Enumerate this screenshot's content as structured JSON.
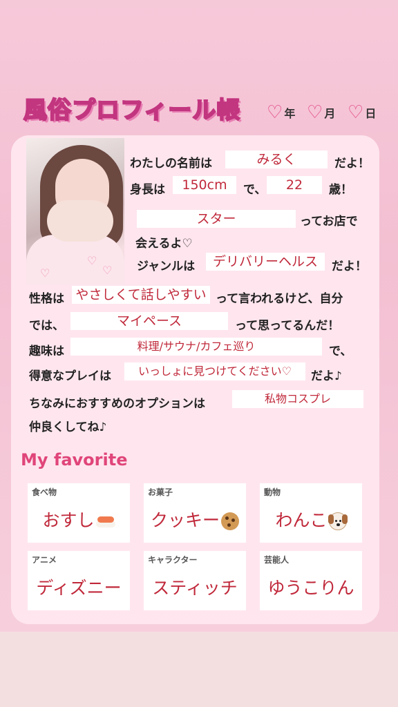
{
  "header": {
    "title": "風俗プロフィール帳",
    "year_label": "年",
    "month_label": "月",
    "day_label": "日"
  },
  "profile": {
    "name_prefix": "わたしの名前は",
    "name": "みるく",
    "name_suffix": "だよ！",
    "height_prefix": "身長は",
    "height": "150cm",
    "height_mid": "で、",
    "age": "22",
    "age_suffix": "歳！",
    "shop": "スター",
    "shop_suffix": "ってお店で",
    "meet_text": "会えるよ♡",
    "genre_prefix": "ジャンルは",
    "genre": "デリバリーヘルス",
    "genre_suffix": "だよ！",
    "personality_prefix": "性格は",
    "personality": "やさしくて話しやすい",
    "personality_suffix": "って言われるけど、自分",
    "self_prefix": "では、",
    "self_view": "マイペース",
    "self_suffix": "って思ってるんだ！",
    "hobby_prefix": "趣味は",
    "hobby": "料理/サウナ/カフェ巡り",
    "hobby_suffix": "で、",
    "play_prefix": "得意なプレイは",
    "play": "いっしょに見つけてください♡",
    "play_suffix": "だよ♪",
    "option_prefix": "ちなみにおすすめのオプションは",
    "option": "私物コスプレ",
    "closing": "仲良くしてね♪"
  },
  "favorites": {
    "title": "My favorite",
    "items": [
      {
        "category": "食べ物",
        "value": "おすし",
        "icon": "sushi-icon"
      },
      {
        "category": "お菓子",
        "value": "クッキー",
        "icon": "cookie-icon"
      },
      {
        "category": "動物",
        "value": "わんこ",
        "icon": "dog-icon"
      },
      {
        "category": "アニメ",
        "value": "ディズニー"
      },
      {
        "category": "キャラクター",
        "value": "スティッチ"
      },
      {
        "category": "芸能人",
        "value": "ゆうこりん"
      }
    ]
  },
  "colors": {
    "accent": "#e2407f",
    "value_text": "#c0283a",
    "card_bg": "#ffe8f0"
  }
}
